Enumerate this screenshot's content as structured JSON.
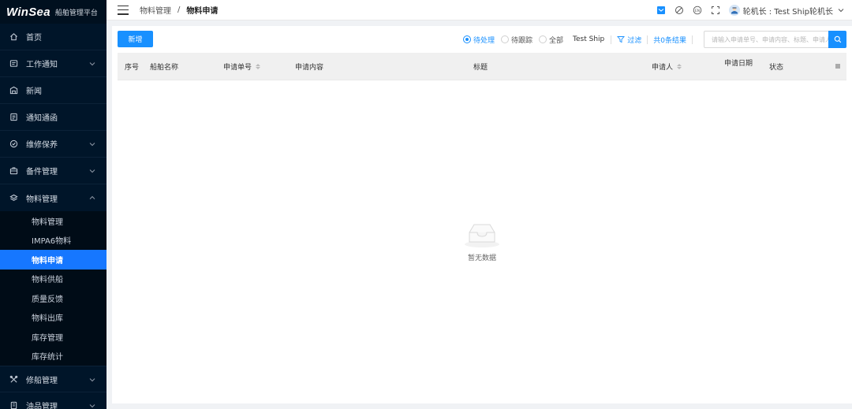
{
  "app": {
    "logo": "WinSea",
    "subtitle": "船舶管理平台"
  },
  "sidebar": {
    "items": [
      {
        "label": "首页",
        "icon": "home-icon",
        "expandable": false
      },
      {
        "label": "工作通知",
        "icon": "message-icon",
        "expandable": true
      },
      {
        "label": "新闻",
        "icon": "news-icon",
        "expandable": false
      },
      {
        "label": "通知通函",
        "icon": "notice-icon",
        "expandable": false
      },
      {
        "label": "维修保养",
        "icon": "maintenance-icon",
        "expandable": true
      },
      {
        "label": "备件管理",
        "icon": "briefcase-icon",
        "expandable": true
      },
      {
        "label": "物料管理",
        "icon": "layers-icon",
        "expandable": true,
        "expanded": true
      }
    ],
    "submenu": [
      {
        "label": "物料管理"
      },
      {
        "label": "IMPA6物料"
      },
      {
        "label": "物料申请",
        "active": true
      },
      {
        "label": "物料供船"
      },
      {
        "label": "质量反馈"
      },
      {
        "label": "物料出库"
      },
      {
        "label": "库存管理"
      },
      {
        "label": "库存统计"
      }
    ],
    "bottom_items": [
      {
        "label": "修船管理",
        "icon": "tools-icon",
        "expandable": true
      },
      {
        "label": "油品管理",
        "icon": "oil-icon",
        "expandable": true
      }
    ]
  },
  "header": {
    "breadcrumb": [
      "物料管理",
      "物料申请"
    ],
    "user": "轮机长 : Test Ship轮机长",
    "accent": "#1890ff"
  },
  "toolbar": {
    "add_label": "新增",
    "radios": [
      {
        "label": "待处理",
        "checked": true
      },
      {
        "label": "待跟踪",
        "checked": false
      },
      {
        "label": "全部",
        "checked": false
      }
    ],
    "ship": "Test Ship",
    "filter_label": "过滤",
    "total_label": "共0条结果",
    "search_placeholder": "请输入申请单号、申请内容、标题、申请人"
  },
  "table": {
    "columns": [
      {
        "label": "序号",
        "sortable": false
      },
      {
        "label": "船舶名称",
        "sortable": false
      },
      {
        "label": "申请单号",
        "sortable": true
      },
      {
        "label": "申请内容",
        "sortable": false
      },
      {
        "label": "标题",
        "sortable": false
      },
      {
        "label": "申请人",
        "sortable": true
      },
      {
        "label": "申请日期",
        "sortable": false
      },
      {
        "label": "状态",
        "sortable": false
      }
    ],
    "rows": [],
    "empty_text": "暂无数据"
  }
}
